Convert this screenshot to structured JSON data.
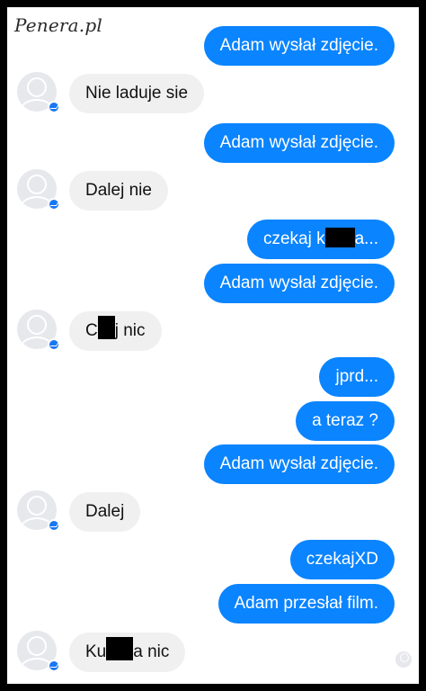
{
  "watermark": "Penera.pl",
  "messages": [
    {
      "dir": "out",
      "text": "Adam wysłał zdjęcie."
    },
    {
      "dir": "in",
      "text": "Nie laduje sie"
    },
    {
      "dir": "out",
      "text": "Adam wysłał zdjęcie."
    },
    {
      "dir": "in",
      "text": "Dalej nie"
    },
    {
      "dir": "out",
      "pre": "czekaj k",
      "post": "a..."
    },
    {
      "dir": "out",
      "text": "Adam wysłał zdjęcie."
    },
    {
      "dir": "in",
      "pre": "C",
      "post": "j nic"
    },
    {
      "dir": "out",
      "text": "jprd..."
    },
    {
      "dir": "out",
      "text": "a teraz ?"
    },
    {
      "dir": "out",
      "text": "Adam wysłał zdjęcie."
    },
    {
      "dir": "in",
      "text": "Dalej"
    },
    {
      "dir": "out",
      "text": "czekajXD"
    },
    {
      "dir": "out",
      "text": "Adam przesłał film."
    },
    {
      "dir": "in",
      "pre": "Ku",
      "post": "a nic"
    }
  ],
  "colors": {
    "outgoing": "#0a84ff",
    "incoming": "#f0f0f0",
    "badge": "#1877f2"
  },
  "icons": {
    "avatar": "default-user-avatar-icon",
    "badge": "messenger-badge-icon"
  }
}
